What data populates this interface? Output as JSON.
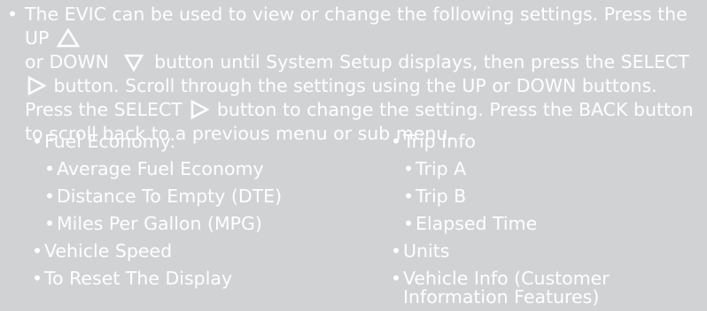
{
  "intro": {
    "bullet": "•",
    "t1": "The EVIC can be used to view or change the following settings. Press the UP",
    "t2": "or DOWN",
    "t3": "button until System Setup displays, then press the SELECT",
    "t4": "button. Scroll through the settings using the UP or DOWN buttons. Press the SELECT",
    "t5": "button to change the setting. Press the BACK button to scroll back to a previous menu or sub menu."
  },
  "left_list": [
    {
      "level": 1,
      "text": "Fuel Economy:"
    },
    {
      "level": 2,
      "text": "Average Fuel Economy"
    },
    {
      "level": 2,
      "text": "Distance To Empty (DTE)"
    },
    {
      "level": 2,
      "text": "Miles Per Gallon (MPG)"
    },
    {
      "level": 1,
      "text": "Vehicle Speed"
    },
    {
      "level": 1,
      "text": "To Reset The Display"
    }
  ],
  "right_list": [
    {
      "level": 1,
      "text": "Trip Info"
    },
    {
      "level": 2,
      "text": "Trip A"
    },
    {
      "level": 2,
      "text": "Trip B"
    },
    {
      "level": 2,
      "text": "Elapsed Time"
    },
    {
      "level": 1,
      "text": "Units"
    },
    {
      "level": 1,
      "text": "Vehicle Info (Customer Information Features)"
    }
  ],
  "icons": {
    "up": "up-triangle-icon",
    "down": "down-triangle-icon",
    "select": "right-triangle-icon"
  },
  "colors": {
    "background": "#d1d2d4",
    "text": "#ffffff"
  }
}
